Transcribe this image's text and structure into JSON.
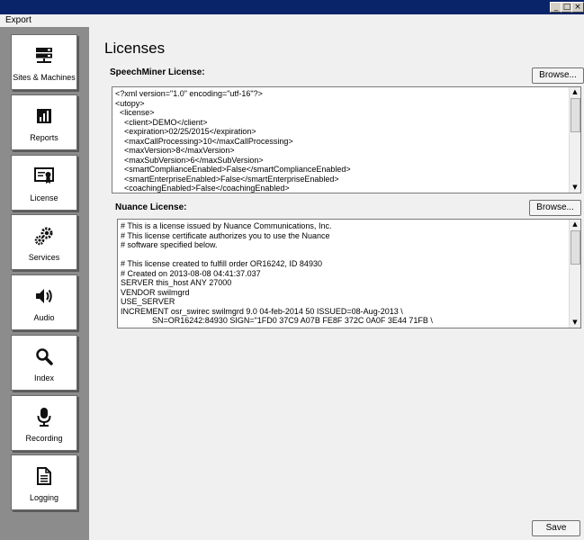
{
  "menubar": {
    "export_label": "Export"
  },
  "window_controls": {
    "minimize": "_",
    "maximize": "□",
    "close": "×"
  },
  "sidebar": {
    "items": [
      {
        "label": "Sites & Machines",
        "icon": "server-icon"
      },
      {
        "label": "Reports",
        "icon": "chart-icon"
      },
      {
        "label": "License",
        "icon": "certificate-icon"
      },
      {
        "label": "Services",
        "icon": "gears-icon"
      },
      {
        "label": "Audio",
        "icon": "speaker-icon"
      },
      {
        "label": "Index",
        "icon": "magnifier-icon"
      },
      {
        "label": "Recording",
        "icon": "microphone-icon"
      },
      {
        "label": "Logging",
        "icon": "document-icon"
      }
    ]
  },
  "main": {
    "title": "Licenses",
    "speechminer": {
      "label": "SpeechMiner License:",
      "browse_label": "Browse...",
      "content": "<?xml version=\"1.0\" encoding=\"utf-16\"?>\n<utopy>\n  <license>\n    <client>DEMO</client>\n    <expiration>02/25/2015</expiration>\n    <maxCallProcessing>10</maxCallProcessing>\n    <maxVersion>8</maxVersion>\n    <maxSubVersion>6</maxSubVersion>\n    <smartComplianceEnabled>False</smartComplianceEnabled>\n    <smartEnterpriseEnabled>False</smartEnterpriseEnabled>\n    <coachingEnabled>False</coachingEnabled>"
    },
    "nuance": {
      "label": "Nuance License:",
      "browse_label": "Browse...",
      "content": "# This is a license issued by Nuance Communications, Inc.\n# This license certificate authorizes you to use the Nuance\n# software specified below.\n\n# This license created to fulfill order OR16242, ID 84930\n# Created on 2013-08-08 04:41:37.037\nSERVER this_host ANY 27000\nVENDOR swilmgrd\nUSE_SERVER\nINCREMENT osr_swirec swilmgrd 9.0 04-feb-2014 50 ISSUED=08-Aug-2013 \\\n              SN=OR16242:84930 SIGN=\"1FD0 37C9 A07B FE8F 372C 0A0F 3E44 71FB \\"
    },
    "save_label": "Save"
  }
}
